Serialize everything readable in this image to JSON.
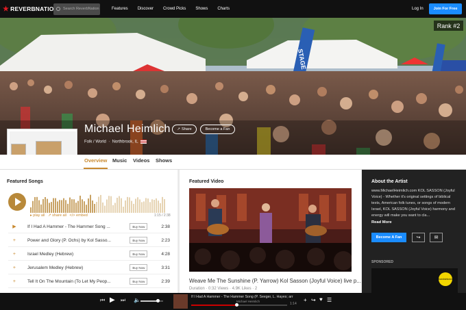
{
  "nav": {
    "logo": "REVERBNATION",
    "search_placeholder": "Search ReverbNation",
    "links": [
      "Features",
      "Discover",
      "Crowd Picks",
      "Shows",
      "Charts"
    ],
    "login": "Log In",
    "join": "Join For Free"
  },
  "hero": {
    "rank": "Rank #2",
    "artist": "Michael Heimlich",
    "share": "Share",
    "become_fan": "Become a Fan",
    "genre": "Folk / World",
    "location": "Northbrook, IL",
    "banner_text": "STAGE"
  },
  "tabs": [
    "Overview",
    "Music",
    "Videos",
    "Shows"
  ],
  "songs": {
    "heading": "Featured Songs",
    "play_all": "play all",
    "share_all": "share all",
    "embed": "embed",
    "duration": "1:15 / 2:38",
    "list": [
      {
        "title": "If I Had A Hammer - The Hammer Song ...",
        "buy": "Buy Now",
        "time": "2:38"
      },
      {
        "title": "Power and Glory (P. Ochs) by Kol Sasso...",
        "buy": "Buy Now",
        "time": "2:23"
      },
      {
        "title": "Israel Medley (Hebrew)",
        "buy": "Buy Now",
        "time": "4:28"
      },
      {
        "title": "Jerusalem Medley (Hebrew)",
        "buy": "Buy Now",
        "time": "3:31"
      },
      {
        "title": "Tell It On The Mountain (To Let My Peop...",
        "buy": "Buy Now",
        "time": "2:39"
      }
    ]
  },
  "video": {
    "heading": "Featured Video",
    "title": "Weave Me The Sunshine (P. Yarrow) Kol Sasson (Joyful Voice) live p...",
    "meta": "Duration · 0:32   Views · 4.9K   Likes · 2"
  },
  "about": {
    "heading": "About the Artist",
    "text": "www.MichaelHeimlich.com KOL SASSON (Joyful Voice) - Whether it's original settings of biblical texts, American folk tunes, or songs of modern Israel, KOL SASSON (Joyful Voice) harmony and energy will make you want to cla...",
    "read_more": "Read More",
    "become_fan": "Become A Fan",
    "sponsored": "SPONSORED",
    "ad_badge": "bandsintown"
  },
  "player": {
    "track": "If I Had A Hammer - The Hammer Song (P. Seeger, L. Hayes; arr",
    "artist": "Michael Heimlich",
    "time": "1:14",
    "progress": 0.47,
    "volume": 0.75
  },
  "colors": {
    "accent": "#c8892f",
    "blue": "#1a8cff",
    "brand_red": "#e21b23"
  }
}
